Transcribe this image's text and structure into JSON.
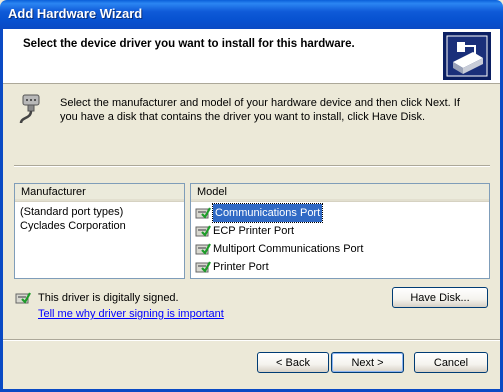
{
  "window": {
    "title": "Add Hardware Wizard"
  },
  "header": {
    "text": "Select the device driver you want to install for this hardware."
  },
  "instructions": "Select the manufacturer and model of your hardware device and then click Next. If you have a disk that contains the driver you want to install, click Have Disk.",
  "manufacturer_list": {
    "header": "Manufacturer",
    "items": [
      "(Standard port types)",
      "Cyclades Corporation"
    ],
    "selected_index": 0
  },
  "model_list": {
    "header": "Model",
    "items": [
      "Communications Port",
      "ECP Printer Port",
      "Multiport Communications Port",
      "Printer Port"
    ],
    "selected_index": 0,
    "item_icon": "signed-driver-icon"
  },
  "signing": {
    "status": "This driver is digitally signed.",
    "link": "Tell me why driver signing is important"
  },
  "buttons": {
    "have_disk": "Have Disk...",
    "back": "< Back",
    "next": "Next >",
    "cancel": "Cancel"
  },
  "colors": {
    "selection": "#316AC5",
    "titlebar": "#0A4AC4",
    "link": "#0000FF"
  }
}
